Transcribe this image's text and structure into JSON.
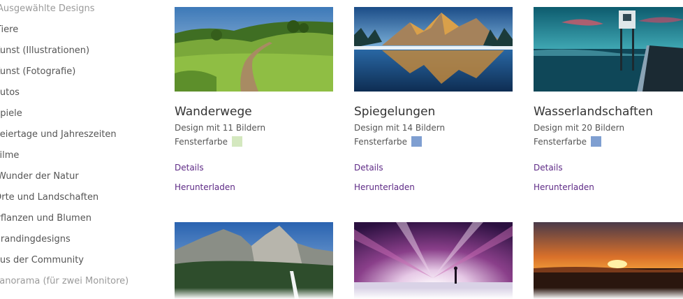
{
  "sidebar": {
    "items": [
      {
        "label": "Ausgewählte Designs"
      },
      {
        "label": "Tiere"
      },
      {
        "label": "Kunst (Illustrationen)"
      },
      {
        "label": "Kunst (Fotografie)"
      },
      {
        "label": "Autos"
      },
      {
        "label": "Spiele"
      },
      {
        "label": "Feiertage und Jahreszeiten"
      },
      {
        "label": "Filme"
      },
      {
        "label": "Wunder der Natur"
      },
      {
        "label": "Orte und Landschaften"
      },
      {
        "label": "Pflanzen und Blumen"
      },
      {
        "label": "Brandingdesigns"
      },
      {
        "label": "Aus der Community"
      },
      {
        "label": "Panorama (für zwei Monitore)"
      }
    ]
  },
  "cards": [
    {
      "title": "Wanderwege",
      "subtitle": "Design mit 11 Bildern",
      "color_label": "Fensterfarbe",
      "swatch_color": "#d4e8bf",
      "details": "Details",
      "download": "Herunterladen"
    },
    {
      "title": "Spiegelungen",
      "subtitle": "Design mit 14 Bildern",
      "color_label": "Fensterfarbe",
      "swatch_color": "#7f9fd1",
      "details": "Details",
      "download": "Herunterladen"
    },
    {
      "title": "Wasserlandschaften",
      "subtitle": "Design mit 20 Bildern",
      "color_label": "Fensterfarbe",
      "swatch_color": "#7f9fd1",
      "details": "Details",
      "download": "Herunterladen"
    }
  ],
  "colors": {
    "link": "#5e2a86",
    "text": "#444444"
  }
}
